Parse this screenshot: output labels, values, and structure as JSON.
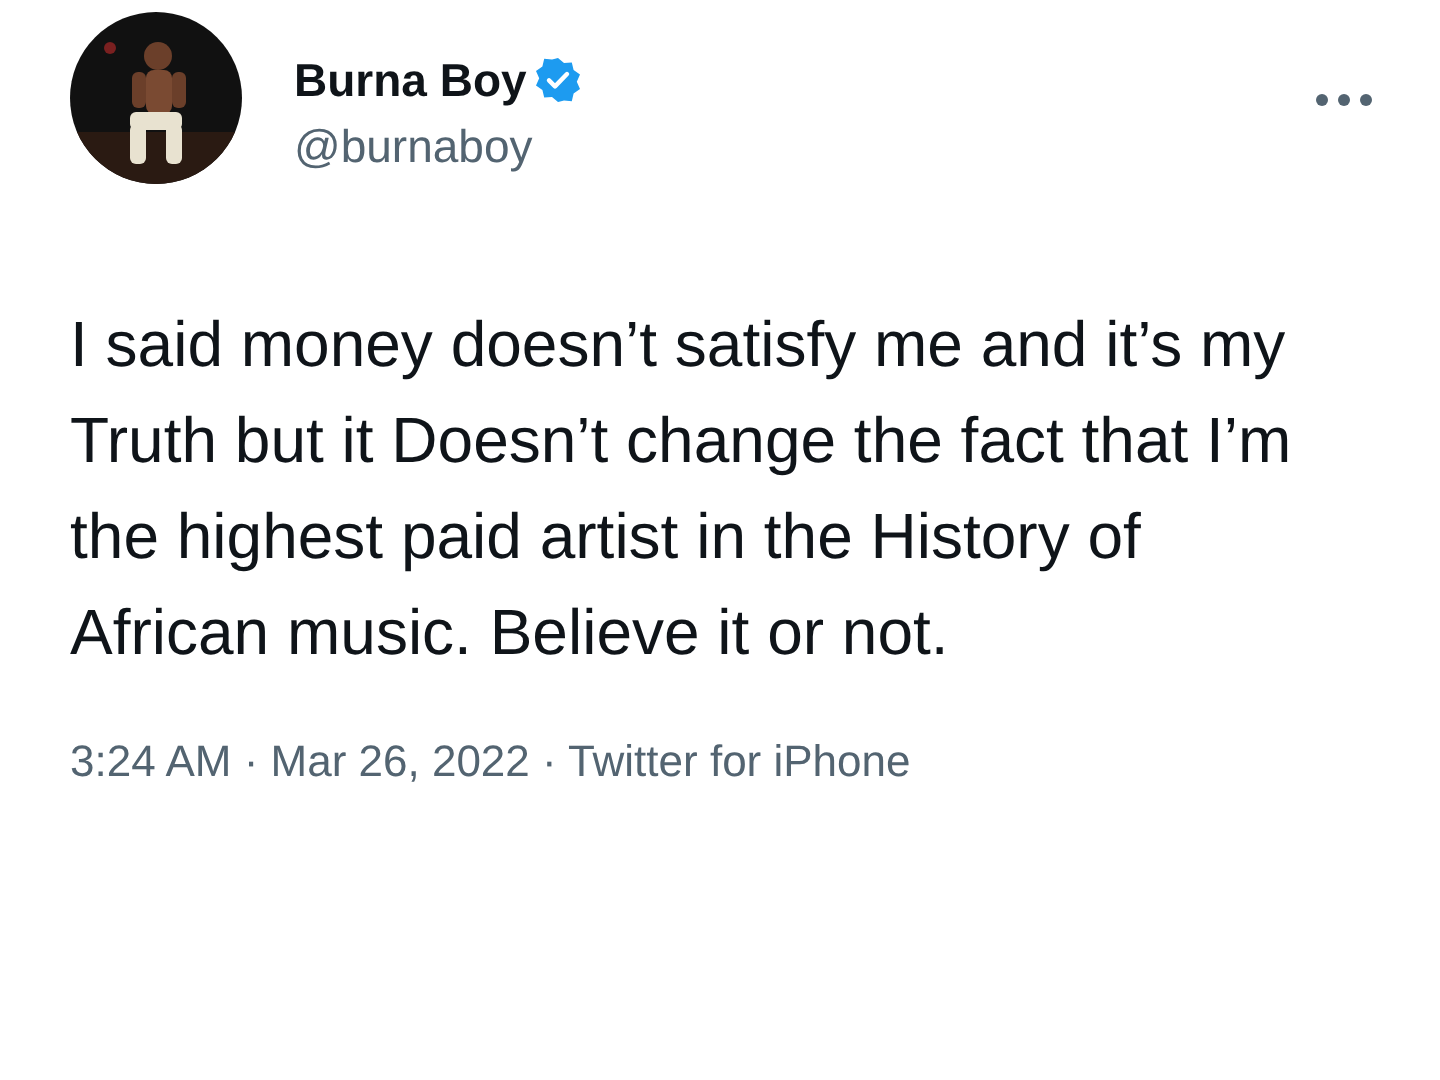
{
  "author": {
    "name": "Burna Boy",
    "verified": true,
    "handle": "@burnaboy"
  },
  "tweet": {
    "text": "I said money doesn’t satisfy me and it’s my Truth but it Doesn’t change the fact that I’m the highest paid artist in the History of African music. Believe it or not.",
    "meta": "3:24 AM · Mar 26, 2022 · Twitter for iPhone"
  }
}
